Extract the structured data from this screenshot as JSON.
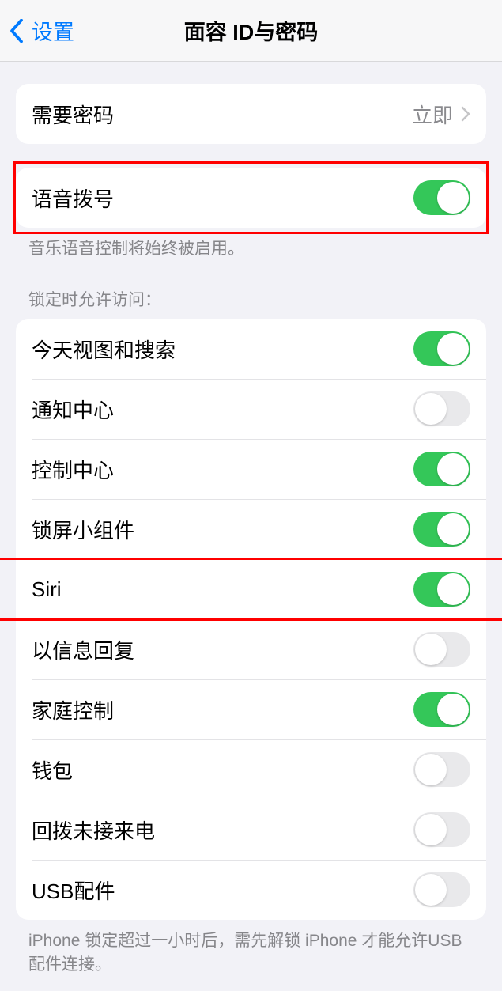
{
  "nav": {
    "back": "设置",
    "title": "面容 ID与密码"
  },
  "passcode_group": {
    "require_label": "需要密码",
    "require_value": "立即"
  },
  "voice_dial": {
    "label": "语音拨号",
    "on": true,
    "footer": "音乐语音控制将始终被启用。"
  },
  "lock_access": {
    "header": "锁定时允许访问：",
    "items": [
      {
        "label": "今天视图和搜索",
        "on": true
      },
      {
        "label": "通知中心",
        "on": false
      },
      {
        "label": "控制中心",
        "on": true
      },
      {
        "label": "锁屏小组件",
        "on": true
      },
      {
        "label": "Siri",
        "on": true
      },
      {
        "label": "以信息回复",
        "on": false
      },
      {
        "label": "家庭控制",
        "on": true
      },
      {
        "label": "钱包",
        "on": false
      },
      {
        "label": "回拨未接来电",
        "on": false
      },
      {
        "label": "USB配件",
        "on": false
      }
    ],
    "footer": "iPhone 锁定超过一小时后，需先解锁 iPhone 才能允许USB 配件连接。"
  }
}
